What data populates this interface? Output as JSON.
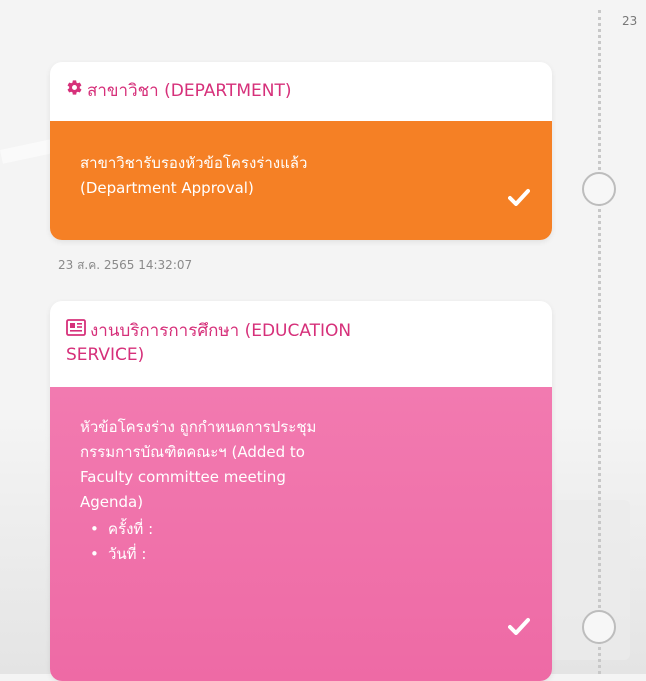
{
  "timeline": {
    "edge_date": "23"
  },
  "card1": {
    "header_icon": "gear-icon",
    "title": "สาขาวิชา (DEPARTMENT)",
    "body_lines": [
      "สาขาวิชารับรองหัวข้อโครงร่างแล้ว",
      "(Department Approval)"
    ],
    "status_icon": "check-icon",
    "color": "#f58025",
    "timestamp": "23 ส.ค. 2565 14:32:07"
  },
  "card2": {
    "header_icon": "newspaper-icon",
    "title_line1": "งานบริการการศึกษา (EDUCATION",
    "title_line2": "SERVICE)",
    "body_lines": [
      "หัวข้อโครงร่าง ถูกกำหนดการประชุม",
      "กรรมการบัณฑิตคณะฯ (Added to",
      "Faculty committee meeting",
      "Agenda)"
    ],
    "list_items": [
      "ครั้งที่ :",
      "วันที่ :"
    ],
    "status_icon": "check-icon",
    "color": "#ee6aa5"
  }
}
